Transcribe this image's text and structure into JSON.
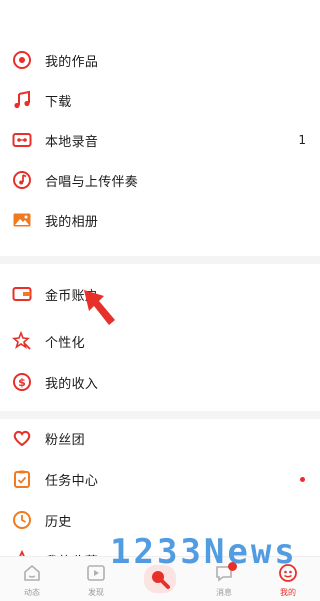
{
  "menu": {
    "items": [
      {
        "label": "我的作品",
        "icon": "target-circle-icon"
      },
      {
        "label": "下载",
        "icon": "music-note-icon"
      },
      {
        "label": "本地录音",
        "icon": "cassette-icon",
        "count": "1"
      },
      {
        "label": "合唱与上传伴奏",
        "icon": "note-circle-icon"
      },
      {
        "label": "我的相册",
        "icon": "photo-album-icon"
      },
      {
        "label": "金币账户",
        "icon": "wallet-icon"
      },
      {
        "label": "个性化",
        "icon": "magic-wand-icon"
      },
      {
        "label": "我的收入",
        "icon": "dollar-circle-icon"
      },
      {
        "label": "粉丝团",
        "icon": "heart-icon"
      },
      {
        "label": "任务中心",
        "icon": "clipboard-check-icon"
      },
      {
        "label": "历史",
        "icon": "clock-icon"
      },
      {
        "label": "我的收藏",
        "icon": "star-icon"
      }
    ]
  },
  "tabbar": {
    "tabs": [
      {
        "label": "动态",
        "icon": "home-icon"
      },
      {
        "label": "发现",
        "icon": "play-video-icon"
      },
      {
        "label": "",
        "icon": "microphone-icon"
      },
      {
        "label": "消息",
        "icon": "chat-bubble-icon"
      },
      {
        "label": "我的",
        "icon": "profile-face-icon",
        "active": true
      }
    ]
  },
  "watermark": {
    "text": "1233News"
  },
  "colors": {
    "accent": "#e8302a",
    "icon_orange": "#f07a20",
    "watermark": "#3b8fde"
  }
}
